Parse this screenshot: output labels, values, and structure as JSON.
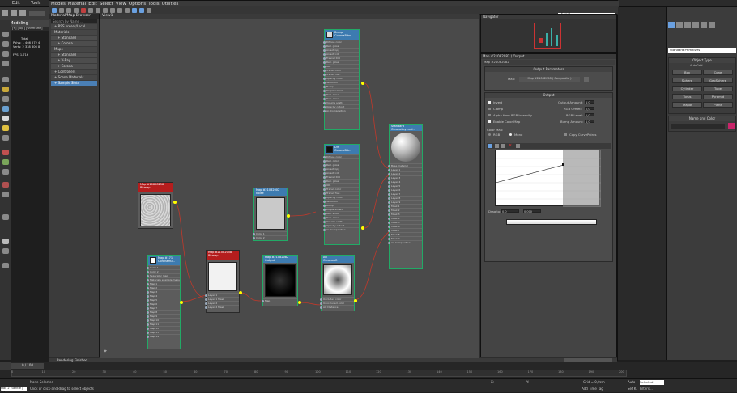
{
  "app": {
    "menus": [
      "Edit",
      "Tools"
    ],
    "modeling_tab": "Modeling",
    "scene_prefix": "[+] [Top ] [Wireframe]"
  },
  "left_stats": {
    "total": "Total",
    "polys": "Polys:",
    "polys_val": "1 466 572 4",
    "verts": "Verts:",
    "verts_val": "2 338 806 8",
    "fps": "FPS:",
    "fps_val": "1.716"
  },
  "slate": {
    "menu": [
      "Modes",
      "Material",
      "Edit",
      "Select",
      "View",
      "Options",
      "Tools",
      "Utilities"
    ],
    "view_select": "View1",
    "view_tab": "View1",
    "status": "Rendering Finished"
  },
  "browser": {
    "title": "Material/Map Browser",
    "search_placeholder": "Search by Name ...",
    "groups": [
      {
        "label": "+ RSS preset/Local",
        "cls": ""
      },
      {
        "label": "Materials",
        "cls": ""
      },
      {
        "label": "+ Standard",
        "cls": "sub"
      },
      {
        "label": "+ Corona",
        "cls": "sub"
      },
      {
        "label": "Maps",
        "cls": ""
      },
      {
        "label": "+ Standard",
        "cls": "sub"
      },
      {
        "label": "+ V-Ray",
        "cls": "sub"
      },
      {
        "label": "+ Corona",
        "cls": "sub"
      },
      {
        "label": "+ Controllers",
        "cls": ""
      },
      {
        "label": "+ Scene Materials",
        "cls": ""
      },
      {
        "label": "+ Sample Slots",
        "cls": "sel"
      }
    ]
  },
  "nodes": {
    "bump_top": {
      "title": "Bump",
      "sub": "CoronaBitm",
      "slots": [
        "Diffuse color",
        "Refl. gloss",
        "Anisotropy",
        "Anisotr.rot",
        "Fresnel IOR",
        "Refr. gloss",
        "IOR",
        "Transl. color",
        "Transl. frac.",
        "Opacity color",
        "Self-illum",
        "Bump",
        "Displacement",
        "Refl. aniso",
        "Refr. aniso",
        "Volume scatt.",
        "Opacity cutout"
      ],
      "footer": "Ar. Composition"
    },
    "diff": {
      "title": "Diff",
      "sub": "CoronaBitm",
      "slots": [
        "Diffuse color",
        "Refl. color",
        "Refl. gloss",
        "Anisotropy",
        "Anisotr.rot",
        "Fresnel IOR",
        "Refr. gloss",
        "IOR",
        "Transl. color",
        "Transl. frac.",
        "Opacity color",
        "Self-illum",
        "Bump",
        "Displacement",
        "Refl. aniso",
        "Refr. aniso",
        "Volume scatt.",
        "Opacity cutout"
      ],
      "footer": "Ar. Composition"
    },
    "standard": {
      "title": "Standard",
      "sub": "CoronaLayered...",
      "slots": [
        "Base material",
        "Layer 1",
        "Layer 2",
        "Layer 3",
        "Layer 4",
        "Layer 5",
        "Layer 6",
        "Layer 7",
        "Layer 8",
        "Layer 9",
        "Mask 1",
        "Mask 2",
        "Mask 3",
        "Mask 4",
        "Mask 5",
        "Mask 6",
        "Mask 7",
        "Mask 8",
        "Mask 9"
      ],
      "footer": "Ar. Composition"
    },
    "bitmap1": {
      "title": "Map #10828258",
      "sub": "Bitmap"
    },
    "noise": {
      "title": "Map #21082002",
      "sub": "Noise",
      "slots": [
        "Color 1",
        "Color 2"
      ]
    },
    "mixmap": {
      "title": "Map #171",
      "sub": "CoronaMu...",
      "slots": [
        "Color 1",
        "Color 2",
        "Separator map",
        "Materials example maps",
        "Map 1",
        "Map 2",
        "Map 3",
        "Map 4",
        "Map 5",
        "Map 6",
        "Map 7",
        "Map 8",
        "Map 9",
        "Map 10",
        "Map 11",
        "Map 12",
        "Map 13",
        "Map 14"
      ]
    },
    "bitmap2": {
      "title": "Map #21082058",
      "sub": "Bitmap",
      "slots": [
        "Layer 1",
        "Layer 1 Mask",
        "Layer 2",
        "Layer 2 Mask"
      ]
    },
    "output": {
      "title": "Map #21082082",
      "sub": "Output",
      "slots": [
        "Map"
      ]
    },
    "ao": {
      "title": "AO",
      "sub": "CoronaAO",
      "slots": [
        "Occluded color",
        "Unoccluded color",
        "AO Distance"
      ]
    }
  },
  "navigator": {
    "title": "Navigator"
  },
  "param": {
    "title": "Map #21082082 ( Output )",
    "sub": "Map #21082082",
    "r1_title": "Output Parameters",
    "map_label": "Map:",
    "map_value": "Map #21082058 ( Composite )",
    "r2_title": "Output",
    "invert": "Invert",
    "clamp": "Clamp",
    "alpha_rgb": "Alpha from RGB Intensity",
    "enable_color_map": "Enable Color Map",
    "out_amount": "Output Amount:",
    "out_amount_v": "1,0",
    "rgb_offset": "RGB Offset:",
    "rgb_offset_v": "0,0",
    "rgb_level": "RGB Level:",
    "rgb_level_v": "1,0",
    "bump_amount": "Bump Amount:",
    "bump_amount_v": "1,0",
    "color_map": "Color Map:",
    "rgb": "RGB",
    "mono": "Mono",
    "copy_cp": "Copy CurvePoints",
    "drag_to": "Drag to:",
    "v1": "0,0",
    "v2": "0,000"
  },
  "command": {
    "dropdown": "Standard Primitives",
    "object_type": "Object Type",
    "autogrid": "AutoGrid",
    "buttons": [
      "Box",
      "Cone",
      "Sphere",
      "GeoSphere",
      "Cylinder",
      "Tube",
      "Torus",
      "Pyramid",
      "Teapot",
      "Plane"
    ],
    "name_color": "Name and Color",
    "color": "#c8256a"
  },
  "timeline": {
    "ticks": [
      "0",
      "10",
      "20",
      "30",
      "40",
      "50",
      "60",
      "70",
      "80",
      "90",
      "100",
      "110",
      "120",
      "130",
      "140",
      "150",
      "160",
      "170",
      "180",
      "190",
      "200"
    ],
    "frame": "0 / 100"
  },
  "status": {
    "none": "None Selected",
    "hint": "Click or click-and-drag to select objects",
    "x": "X:",
    "y": "Y:",
    "grid": "Grid = 0,0cm",
    "addtime": "Add Time Tag",
    "auto": "Auto",
    "selected": "Selected",
    "setkey": "Set K.",
    "filters": "Filters...",
    "script": "Max 2 cuentre | ins"
  }
}
